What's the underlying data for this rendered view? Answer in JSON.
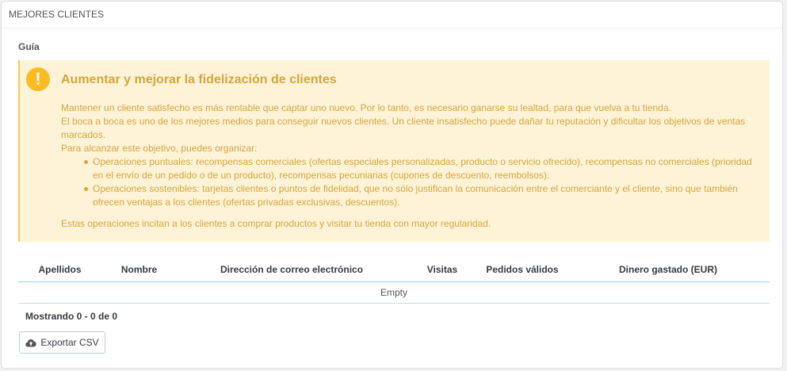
{
  "panel": {
    "title": "MEJORES CLIENTES"
  },
  "guide": {
    "title": "Guía"
  },
  "alert": {
    "icon": "warning-icon",
    "heading": "Aumentar y mejorar la fidelización de clientes",
    "line1": "Mantener un cliente satisfecho es más rentable que captar uno nuevo. Por lo tanto, es necesario ganarse su lealtad, para que vuelva a tu tienda.",
    "line2": "El boca a boca es uno de los mejores medios para conseguir nuevos clientes. Un cliente insatisfecho puede dañar tu reputación y dificultar los objetivos de ventas marcados.",
    "line3": "Para alcanzar este objetivo, puedes organizar:",
    "items": [
      "Operaciones puntuales: recompensas comerciales (ofertas especiales personalizadas, producto o servicio ofrecido), recompensas no comerciales (prioridad en el envío de un pedido o de un producto), recompensas pecuniarias (cupones de descuento, reembolsos).",
      "Operaciones sostenibles: tarjetas clientes o puntos de fidelidad, que no sólo justifican la comunicación entre el comerciante y el cliente, sino que también ofrecen ventajas a los clientes (ofertas privadas exclusivas, descuentos)."
    ],
    "final": "Estas operaciones incitan a los clientes a comprar productos y visitar tu tienda con mayor regularidad."
  },
  "table": {
    "columns": [
      "Apellidos",
      "Nombre",
      "Dirección de correo electrónico",
      "Visitas",
      "Pedidos válidos",
      "Dinero gastado (EUR)"
    ],
    "empty_text": "Empty"
  },
  "pagination": {
    "text": "Mostrando 0 - 0 de 0"
  },
  "export": {
    "label": "Exportar CSV",
    "icon": "cloud-upload-icon"
  }
}
